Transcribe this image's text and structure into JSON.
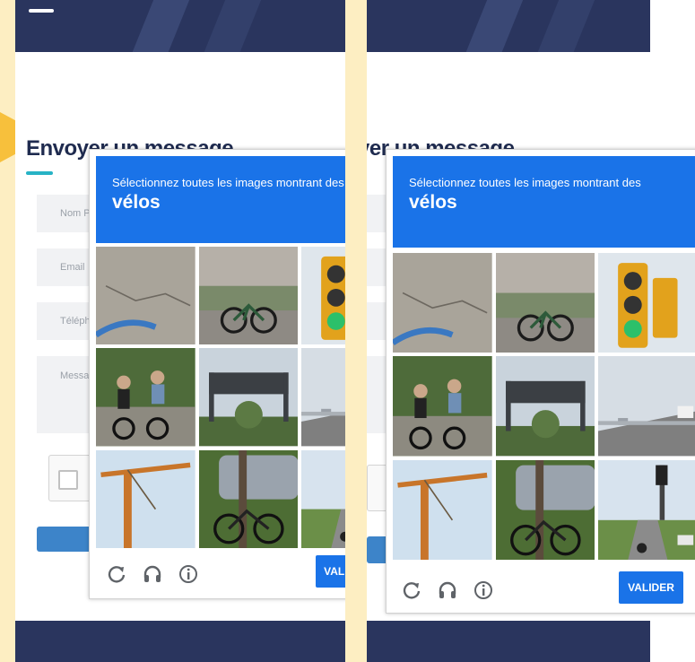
{
  "page": {
    "form_title": "Envoyer un message",
    "form_title_cropped": "yer un message",
    "fields": {
      "name_placeholder": "Nom Prénom",
      "email_placeholder": "Email",
      "phone_placeholder": "Téléphone",
      "message_placeholder": "Message"
    }
  },
  "captcha": {
    "instruction": "Sélectionnez toutes les images montrant des",
    "keyword": "vélos",
    "verify_label": "VALIDER",
    "controls": [
      "reload-icon",
      "headphones-icon",
      "info-icon"
    ],
    "tiles": [
      {
        "scene": "asphalt-road-with-wheel",
        "has_bike": true
      },
      {
        "scene": "street-with-parked-bicycle",
        "has_bike": true
      },
      {
        "scene": "traffic-light",
        "has_bike": false
      },
      {
        "scene": "cyclists-on-path",
        "has_bike": true
      },
      {
        "scene": "highway-sign-gantry",
        "has_bike": false
      },
      {
        "scene": "highway-with-cars",
        "has_bike": false
      },
      {
        "scene": "construction-crane",
        "has_bike": false
      },
      {
        "scene": "bicycle-near-car",
        "has_bike": true
      },
      {
        "scene": "road-with-traffic-light",
        "has_bike": true
      }
    ]
  },
  "colors": {
    "background": "#fdeec2",
    "hero": "#2a355e",
    "captcha_blue": "#1a73e8",
    "accent_teal": "#27b3c5",
    "arrow": "#f7c03c"
  }
}
